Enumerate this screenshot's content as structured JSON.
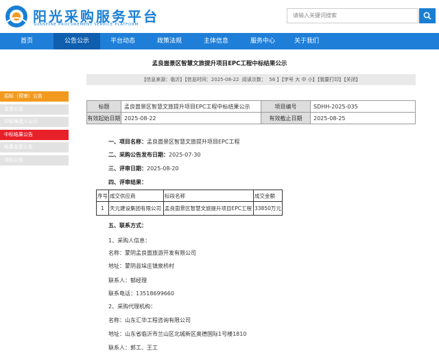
{
  "header": {
    "logo_title": "阳光采购服务平台",
    "logo_subtitle": "SUNSHINE PROCUREMENT SERVICE PLATFORM",
    "search_placeholder": "请输入关键词搜索",
    "brand_color": "#1a7fd4"
  },
  "nav": {
    "items": [
      "首页",
      "公告公示",
      "平台动态",
      "政策法规",
      "主体信息",
      "服务中心",
      "关于我们"
    ],
    "active": "公告公示",
    "color": "#1f7fd8",
    "active_color": "#0f5fae"
  },
  "article": {
    "title": "孟良崮景区智慧文旅提升项目EPC工程中标结果公示",
    "info": "【信息来源：临沂】【信息时间：2025-08-22  阅读次数：  56 】【字号 大 中 小】【我要打印】【关闭】"
  },
  "sidebar": {
    "items": [
      "招标（预审）公告",
      "变更公告",
      "中标候选人公示",
      "中标结果公告",
      "结果变更公告",
      "流标公告"
    ],
    "highlight_orange": "招标（预审）公告",
    "highlight_red": "中标结果公告"
  },
  "info_table": {
    "label_title": "标题",
    "title": "孟良崮景区智慧文旅提升项目EPC工程中标结果公示",
    "label_code": "项目编号",
    "code": "SDHH-2025-035",
    "label_start": "有效起始日期",
    "start": "2025-08-22",
    "label_end": "有效截止日期",
    "end": "2025-08-25"
  },
  "content": {
    "s1_label": "一、项目名称：",
    "s1_value": "孟良崮景区智慧文旅提升项目EPC工程",
    "s2_label": "二、采购公告发布日期：",
    "s2_value": "2025-07-30",
    "s3_label": "三、评审日期：",
    "s3_value": "2025-08-20",
    "s4_label": "四、评审结果：",
    "result_headers": [
      "序号",
      "成交供应商",
      "标段名称",
      "成交金额"
    ],
    "result_row": [
      "1",
      "天元建设集团有限公司",
      "孟良崮景区智慧文旅提升项目EPC工程",
      "33850万元"
    ],
    "s5_label": "五、联系方式：",
    "p1": "1、采购人信息：",
    "p1_name": "名称：蒙阴孟良崮旅游开发有限公司",
    "p1_addr": "地址：蒙阴县垛庄镇泉桥村",
    "p1_contact": "联系人：郁经理",
    "p1_phone": "联系电话：13518699660",
    "p2": "2、采购代理机构：",
    "p2_name": "名称：山东汇华工程咨询有限公司",
    "p2_addr": "地址：山东省临沂市兰山区北城新区奥德国际1号楼1810",
    "p2_contact": "联系人：郭工、王工"
  }
}
